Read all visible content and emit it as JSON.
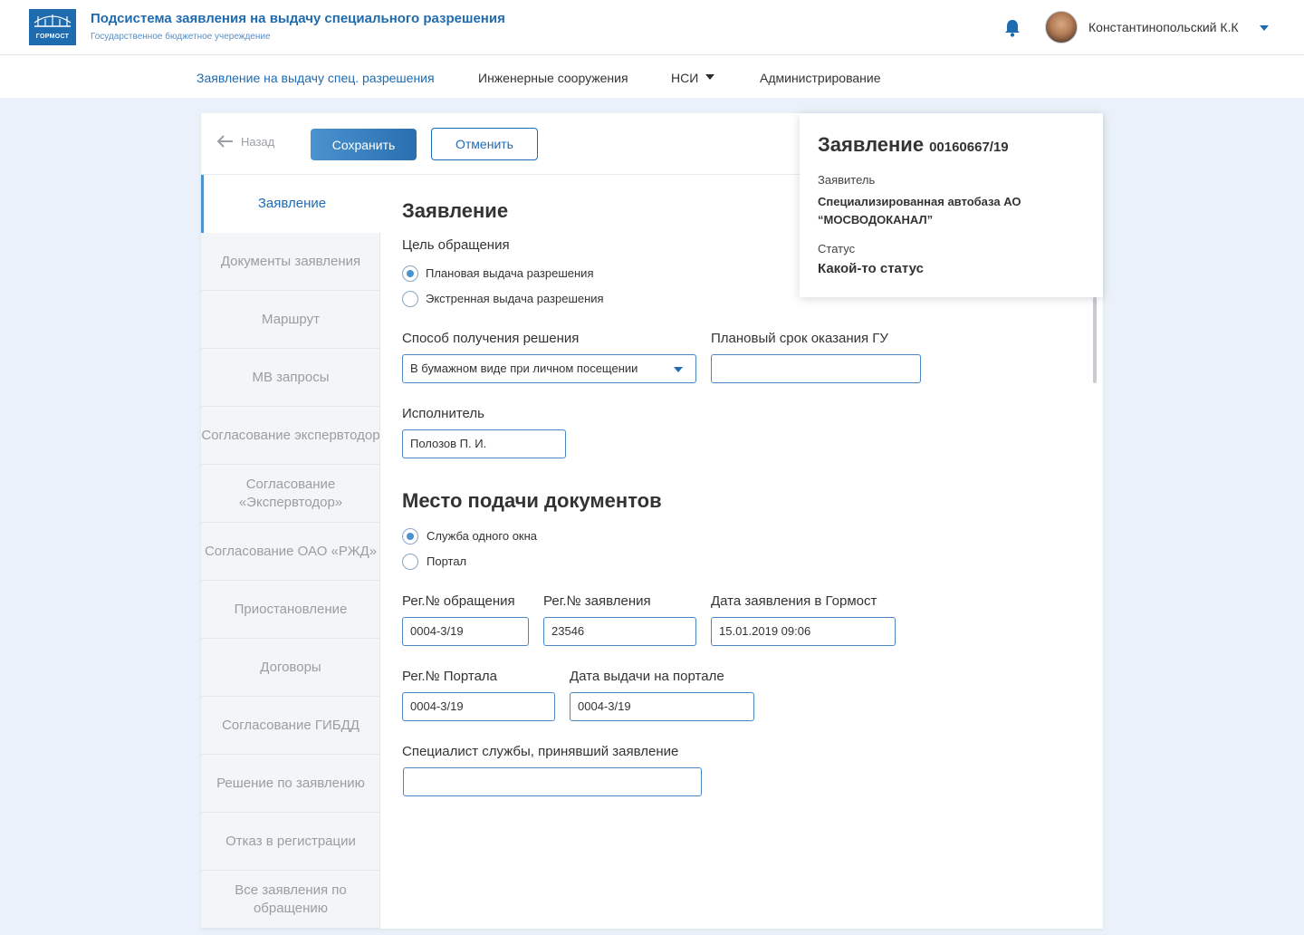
{
  "header": {
    "logo_text": "ГОРМОСТ",
    "app_title": "Подсистема заявления на выдачу специального разрешения",
    "app_subtitle": "Государственное бюджетное учереждение",
    "user_name": "Константинопольский К.К"
  },
  "nav": {
    "items": [
      {
        "label": "Заявление на выдачу спец. разрешения",
        "active": true
      },
      {
        "label": "Инженерные сооружения"
      },
      {
        "label": "НСИ",
        "has_dropdown": true
      },
      {
        "label": "Администрирование"
      }
    ]
  },
  "toolbar": {
    "back_label": "Назад",
    "save_label": "Сохранить",
    "cancel_label": "Отменить"
  },
  "sidebar": {
    "items": [
      {
        "label": "Заявление",
        "active": true
      },
      {
        "label": "Документы заявления"
      },
      {
        "label": "Маршрут"
      },
      {
        "label": "МВ запросы"
      },
      {
        "label": "Согласование экспервтодор"
      },
      {
        "label": "Согласование «Экспервтодор»"
      },
      {
        "label": "Согласование ОАО «РЖД»"
      },
      {
        "label": "Приостановление"
      },
      {
        "label": "Договоры"
      },
      {
        "label": "Согласование ГИБДД"
      },
      {
        "label": "Решение по заявлению"
      },
      {
        "label": "Отказ в регистрации"
      },
      {
        "label": "Все заявления по обращению"
      }
    ]
  },
  "form": {
    "section1_title": "Заявление",
    "purpose_label": "Цель обращения",
    "purpose_options": [
      {
        "label": "Плановая выдача разрешения",
        "checked": true
      },
      {
        "label": "Экстренная выдача разрешения",
        "checked": false
      }
    ],
    "method_label": "Способ получения решения",
    "method_value": "В бумажном виде при личном посещении",
    "planned_term_label": "Плановый срок оказания ГУ",
    "planned_term_value": "",
    "executor_label": "Исполнитель",
    "executor_value": "Полозов П. И.",
    "section2_title": "Место подачи документов",
    "place_options": [
      {
        "label": "Служба одного окна",
        "checked": true
      },
      {
        "label": "Портал",
        "checked": false
      }
    ],
    "reg_appeal_label": "Рег.№ обращения",
    "reg_appeal_value": "0004-3/19",
    "reg_application_label": "Рег.№ заявления",
    "reg_application_value": "23546",
    "date_gormost_label": "Дата заявления в Гормост",
    "date_gormost_value": "15.01.2019 09:06",
    "reg_portal_label": "Рег.№ Портала",
    "reg_portal_value": "0004-3/19",
    "portal_date_label": "Дата выдачи на портале",
    "portal_date_value": "0004-3/19",
    "specialist_label": "Специалист службы, принявший заявление",
    "specialist_value": ""
  },
  "info": {
    "title": "Заявление",
    "number": "00160667/19",
    "applicant_label": "Заявитель",
    "applicant_value": "Специализированная автобаза АО “МОСВОДОКАНАЛ”",
    "status_label": "Статус",
    "status_value": "Какой-то статус"
  },
  "colors": {
    "primary": "#1f6bb0",
    "accent": "#4a93cf",
    "background": "#eaf1fa"
  }
}
